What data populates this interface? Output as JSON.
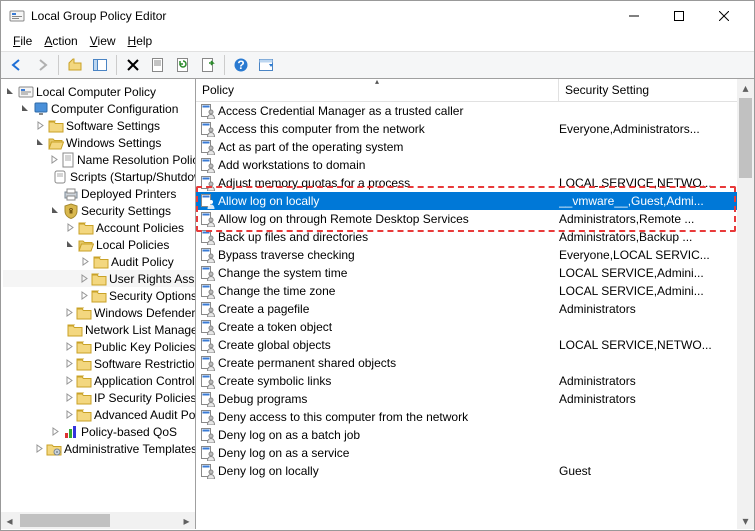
{
  "window": {
    "title": "Local Group Policy Editor"
  },
  "menubar": {
    "file": "File",
    "action": "Action",
    "view": "View",
    "help": "Help"
  },
  "columns": {
    "policy": "Policy",
    "security": "Security Setting"
  },
  "tree": {
    "root": "Local Computer Policy",
    "cc": "Computer Configuration",
    "ss": "Software Settings",
    "ws": "Windows Settings",
    "nr": "Name Resolution Policy",
    "scripts": "Scripts (Startup/Shutdown)",
    "dp": "Deployed Printers",
    "sec": "Security Settings",
    "ap": "Account Policies",
    "lp": "Local Policies",
    "audit": "Audit Policy",
    "ura": "User Rights Assignment",
    "secopt": "Security Options",
    "wdf": "Windows Defender Firewall with Advanced Security",
    "nlm": "Network List Manager Policies",
    "pkp": "Public Key Policies",
    "srp": "Software Restriction Policies",
    "acp": "Application Control Policies",
    "ipsec": "IP Security Policies on Local Computer",
    "aac": "Advanced Audit Policy Configuration",
    "qos": "Policy-based QoS",
    "at": "Administrative Templates"
  },
  "policies": [
    {
      "name": "Access Credential Manager as a trusted caller",
      "setting": ""
    },
    {
      "name": "Access this computer from the network",
      "setting": "Everyone,Administrators..."
    },
    {
      "name": "Act as part of the operating system",
      "setting": ""
    },
    {
      "name": "Add workstations to domain",
      "setting": ""
    },
    {
      "name": "Adjust memory quotas for a process",
      "setting": "LOCAL SERVICE,NETWO..."
    },
    {
      "name": "Allow log on locally",
      "setting": "__vmware__,Guest,Admi..."
    },
    {
      "name": "Allow log on through Remote Desktop Services",
      "setting": "Administrators,Remote ..."
    },
    {
      "name": "Back up files and directories",
      "setting": "Administrators,Backup ..."
    },
    {
      "name": "Bypass traverse checking",
      "setting": "Everyone,LOCAL SERVIC..."
    },
    {
      "name": "Change the system time",
      "setting": "LOCAL SERVICE,Admini..."
    },
    {
      "name": "Change the time zone",
      "setting": "LOCAL SERVICE,Admini..."
    },
    {
      "name": "Create a pagefile",
      "setting": "Administrators"
    },
    {
      "name": "Create a token object",
      "setting": ""
    },
    {
      "name": "Create global objects",
      "setting": "LOCAL SERVICE,NETWO..."
    },
    {
      "name": "Create permanent shared objects",
      "setting": ""
    },
    {
      "name": "Create symbolic links",
      "setting": "Administrators"
    },
    {
      "name": "Debug programs",
      "setting": "Administrators"
    },
    {
      "name": "Deny access to this computer from the network",
      "setting": ""
    },
    {
      "name": "Deny log on as a batch job",
      "setting": ""
    },
    {
      "name": "Deny log on as a service",
      "setting": ""
    },
    {
      "name": "Deny log on locally",
      "setting": "Guest"
    }
  ],
  "layout": {
    "policy_col_width": 363,
    "security_col_width": 150,
    "selected_policy_index": 5,
    "highlight_start_index": 5,
    "highlight_end_index": 6
  }
}
